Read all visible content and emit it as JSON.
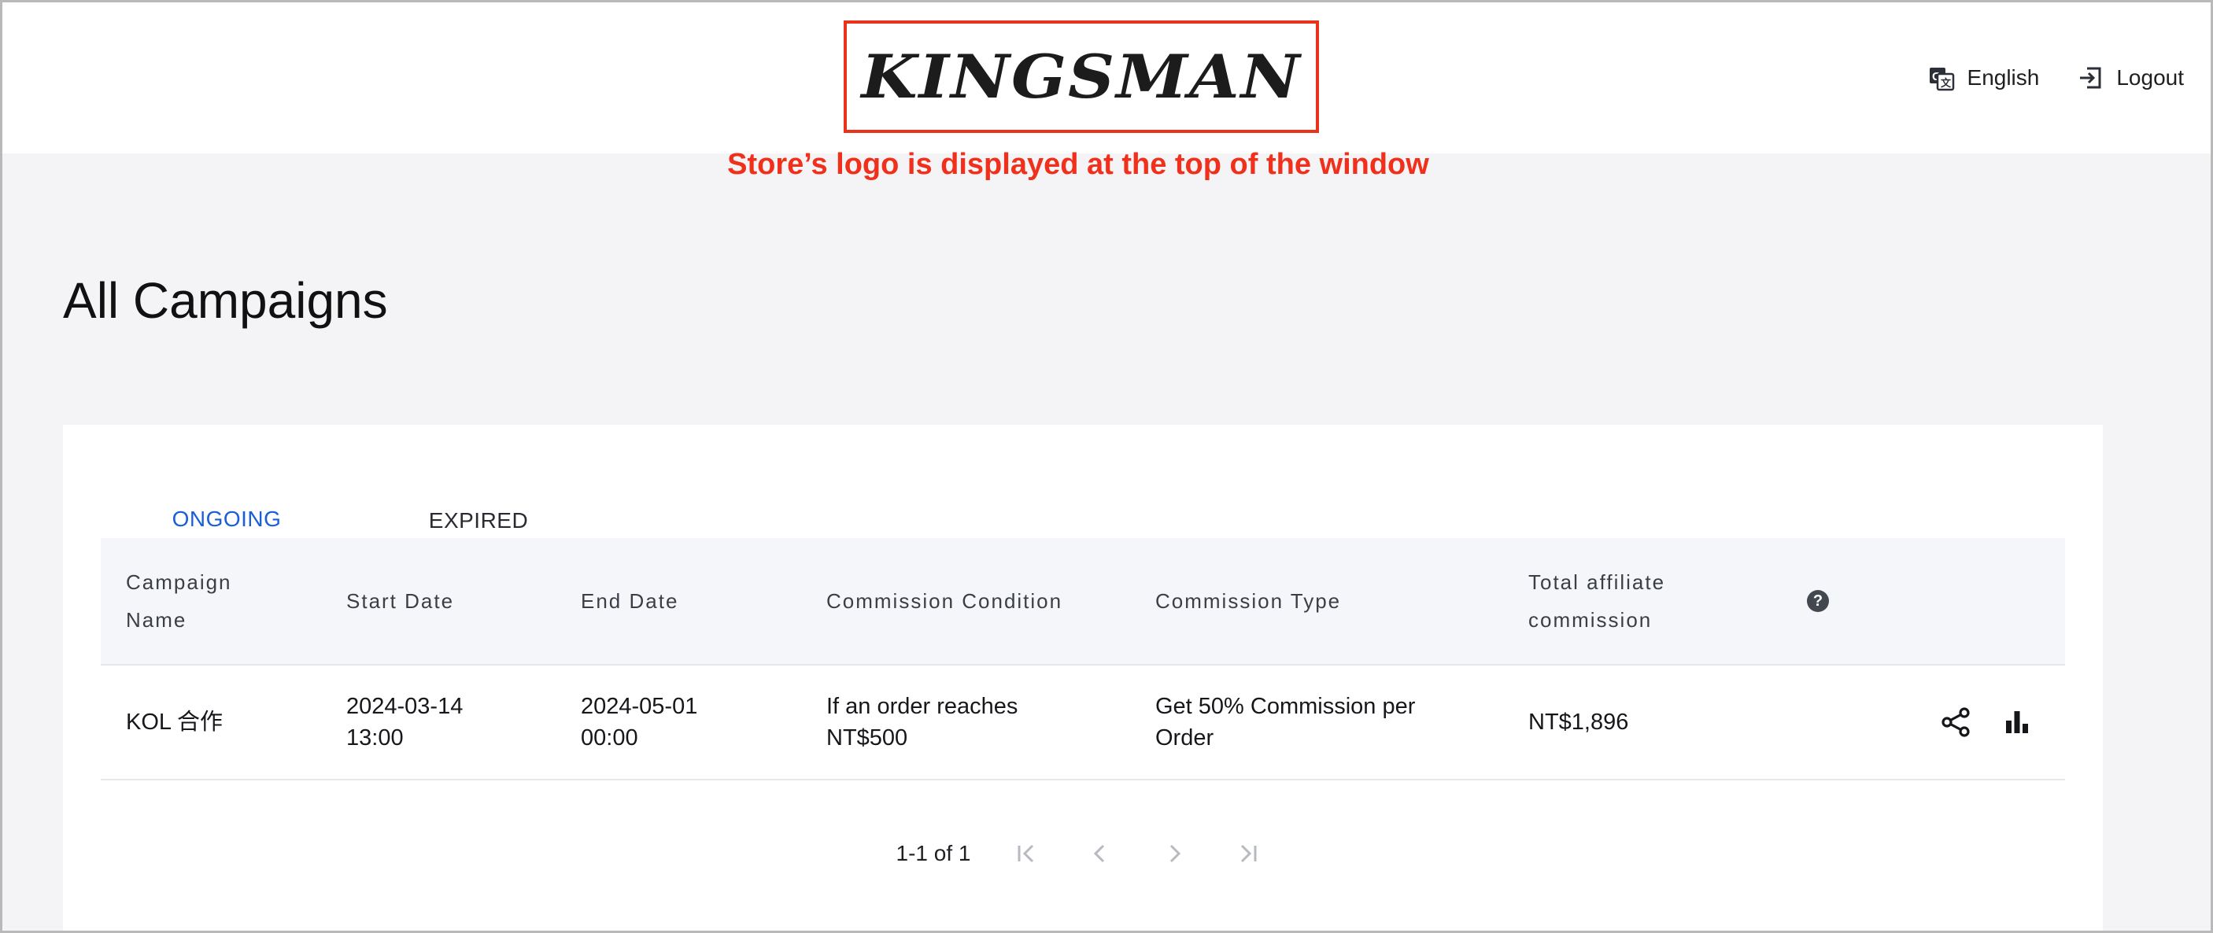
{
  "header": {
    "logo_text": "KINGSMAN",
    "annotation": "Store’s logo is displayed at the top of the window",
    "language_label": "English",
    "logout_label": "Logout"
  },
  "page": {
    "title": "All Campaigns"
  },
  "tabs": [
    {
      "label": "ONGOING",
      "active": true
    },
    {
      "label": "EXPIRED",
      "active": false
    }
  ],
  "table": {
    "headers": {
      "campaign_name_1": "Campaign",
      "campaign_name_2": "Name",
      "start_date": "Start Date",
      "end_date": "End Date",
      "commission_condition": "Commission Condition",
      "commission_type": "Commission Type",
      "total_1": "Total affiliate",
      "total_2": "commission",
      "help": "?"
    },
    "rows": [
      {
        "campaign_name": "KOL 合作",
        "start_date_1": "2024-03-14",
        "start_date_2": "13:00",
        "end_date_1": "2024-05-01",
        "end_date_2": "00:00",
        "condition_1": "If an order reaches",
        "condition_2": "NT$500",
        "type_1": "Get 50% Commission per",
        "type_2": "Order",
        "total": "NT$1,896"
      }
    ]
  },
  "pagination": {
    "info": "1-1 of 1"
  },
  "colors": {
    "accent": "#1a5fd8",
    "annotation": "#f0301b",
    "logo_border": "#e8321c"
  },
  "icons": [
    "translate-icon",
    "logout-icon",
    "help-icon",
    "share-icon",
    "bar-chart-icon",
    "first-page-icon",
    "prev-page-icon",
    "next-page-icon",
    "last-page-icon"
  ]
}
